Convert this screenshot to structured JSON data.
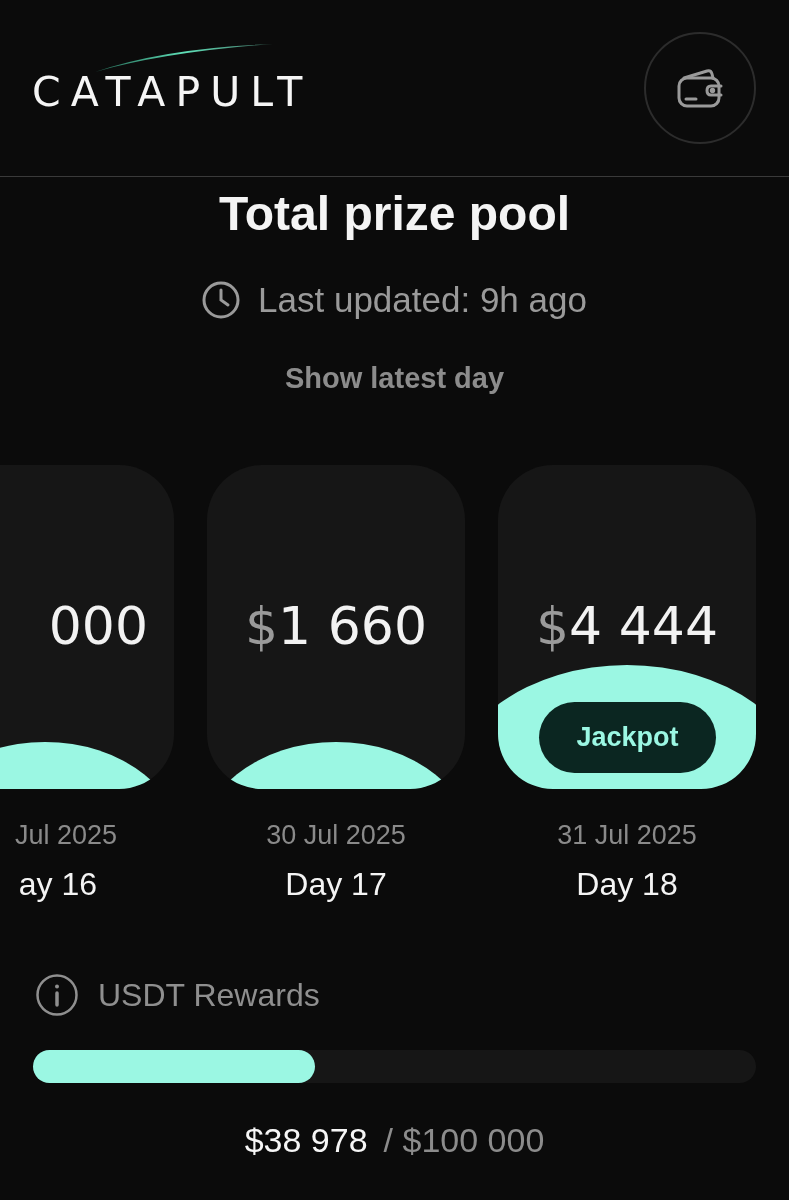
{
  "header": {
    "logo": "CATAPULT"
  },
  "prize_pool": {
    "title": "Total prize pool",
    "last_updated": "Last updated: 9h ago",
    "show_latest_button": "Show latest day"
  },
  "days": [
    {
      "kind": "regular",
      "amount": "000",
      "date": "Jul 2025",
      "day": "ay 16"
    },
    {
      "kind": "regular",
      "currency": "$",
      "amount": "1 660",
      "date": "30 Jul 2025",
      "day": "Day 17"
    },
    {
      "kind": "jackpot",
      "currency": "$",
      "amount": "4 444",
      "badge": "Jackpot",
      "date": "31 Jul 2025",
      "day": "Day 18"
    }
  ],
  "rewards": {
    "label": "USDT Rewards",
    "level": 0.39,
    "current": "$38 978",
    "total": "/ $100 000"
  }
}
